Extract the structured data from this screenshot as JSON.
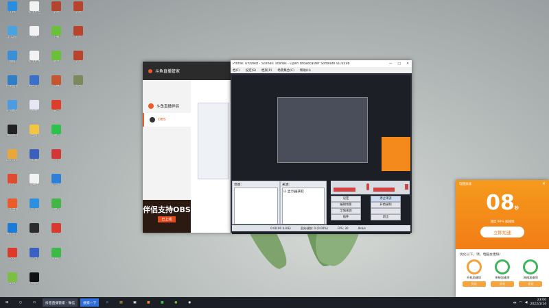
{
  "desktop": {
    "icons": [
      {
        "label": "TIM",
        "color": "#2b8ddf",
        "col": 0,
        "row": 0
      },
      {
        "label": "此电脑",
        "color": "#4aa3df",
        "col": 0,
        "row": 1
      },
      {
        "label": "网络",
        "color": "#3b8fd6",
        "col": 0,
        "row": 2
      },
      {
        "label": "控制面板",
        "color": "#2f7ec9",
        "col": 0,
        "row": 3
      },
      {
        "label": "回收站",
        "color": "#4d9be0",
        "col": 0,
        "row": 4
      },
      {
        "label": "腾讯QQ",
        "color": "#222",
        "col": 0,
        "row": 5
      },
      {
        "label": "Chrome",
        "color": "#e9a63a",
        "col": 0,
        "row": 6
      },
      {
        "label": "WPS",
        "color": "#e04a2f",
        "col": 0,
        "row": 7
      },
      {
        "label": "斗鱼直播",
        "color": "#ec5c2a",
        "col": 0,
        "row": 8
      },
      {
        "label": "腾讯会议",
        "color": "#1d7bd8",
        "col": 0,
        "row": 9
      },
      {
        "label": "Edge",
        "color": "#dc3b2c",
        "col": 0,
        "row": 10
      },
      {
        "label": "360",
        "color": "#7bc043",
        "col": 0,
        "row": 11
      },
      {
        "label": "新建文档",
        "color": "#f2f2f2",
        "col": 1,
        "row": 0
      },
      {
        "label": "文档",
        "color": "#f2f2f2",
        "col": 1,
        "row": 1
      },
      {
        "label": "新建文件",
        "color": "#f2f2f2",
        "col": 1,
        "row": 2
      },
      {
        "label": "文档资料",
        "color": "#3a70c9",
        "col": 1,
        "row": 3
      },
      {
        "label": "表格",
        "color": "#e8e6f4",
        "col": 1,
        "row": 4
      },
      {
        "label": "直播",
        "color": "#f4c542",
        "col": 1,
        "row": 5
      },
      {
        "label": "工具",
        "color": "#3a5fbd",
        "col": 1,
        "row": 6
      },
      {
        "label": "记事本",
        "color": "#f2f2f2",
        "col": 1,
        "row": 7
      },
      {
        "label": "浏览器",
        "color": "#2d8fe0",
        "col": 1,
        "row": 8
      },
      {
        "label": "软件",
        "color": "#2b2b2b",
        "col": 1,
        "row": 9
      },
      {
        "label": "应用",
        "color": "#3a60c2",
        "col": 1,
        "row": 10
      },
      {
        "label": "Player",
        "color": "#111",
        "col": 1,
        "row": 11
      },
      {
        "label": "游戏",
        "color": "#b3452f",
        "col": 2,
        "row": 0
      },
      {
        "label": "下载",
        "color": "#6bbf3a",
        "col": 2,
        "row": 1
      },
      {
        "label": "助手",
        "color": "#6bbf3a",
        "col": 2,
        "row": 2
      },
      {
        "label": "头像",
        "color": "#c4572f",
        "col": 2,
        "row": 3
      },
      {
        "label": "安全",
        "color": "#dd3e2b",
        "col": 2,
        "row": 4
      },
      {
        "label": "微信",
        "color": "#2ec14b",
        "col": 2,
        "row": 5
      },
      {
        "label": "音乐",
        "color": "#d13737",
        "col": 2,
        "row": 6
      },
      {
        "label": "云盘",
        "color": "#2d7fd8",
        "col": 2,
        "row": 7
      },
      {
        "label": "微信",
        "color": "#44b649",
        "col": 2,
        "row": 8
      },
      {
        "label": "WPS",
        "color": "#d93a2f",
        "col": 2,
        "row": 9
      },
      {
        "label": "爱奇艺",
        "color": "#3cba48",
        "col": 2,
        "row": 10
      },
      {
        "label": "游戏",
        "color": "#b8442d",
        "col": 3,
        "row": 0
      },
      {
        "label": "游戏",
        "color": "#b8442d",
        "col": 3,
        "row": 1
      },
      {
        "label": "游戏",
        "color": "#b8442d",
        "col": 3,
        "row": 2
      },
      {
        "label": "图片",
        "color": "#7a8a5a",
        "col": 3,
        "row": 3
      }
    ]
  },
  "douyu": {
    "title": "斗鱼直播管家",
    "nav": [
      {
        "label": "斗鱼直播伴侣",
        "selected": false
      },
      {
        "label": "OBS",
        "selected": true
      }
    ],
    "promo_text": "伴侣支持OBS",
    "promo_btn": "已上线"
  },
  "obs": {
    "title": "Profile: Untitled - Scenes: scenes - Open Broadcaster Software v0.659b",
    "menu": [
      "档(F)",
      "设定(S)",
      "档案(P)",
      "场景集合(C)",
      "帮助(H)"
    ],
    "scenes_label": "场景:",
    "sources_label": "来源:",
    "source_item": "显示器获取",
    "buttons_left": [
      "设定",
      "编辑场景",
      "全域来源",
      "插件"
    ],
    "buttons_right": [
      "停止串流",
      "开始录制",
      "",
      "退出"
    ],
    "status": [
      "0:00:00 (LIVE)",
      "丢失帧数: 0 (0.00%)",
      "FPS: 30",
      "0kb/s"
    ]
  },
  "speedup": {
    "caption": "电脑加速",
    "value": "08",
    "unit": "秒",
    "sub": "速度 99% 超越版",
    "accelerate": "立即加速",
    "tip": "优化以下，项，电脑会更快！",
    "options": [
      {
        "label": "开机加速项",
        "color": "#f4a03a"
      },
      {
        "label": "系统加速项",
        "color": "#3fb45c"
      },
      {
        "label": "网络加速项",
        "color": "#3fb45c"
      }
    ],
    "option_btn": "优化"
  },
  "taskbar": {
    "running": "抖音直播管家 - 微信",
    "search_btn": "搜索一下",
    "time": "23:00",
    "date": "2022/1/14"
  }
}
